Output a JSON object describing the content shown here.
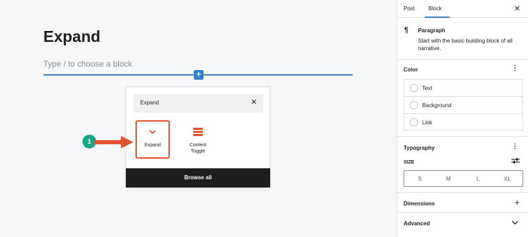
{
  "canvas": {
    "post_title": "Expand",
    "placeholder": "Type / to choose a block",
    "insert_plus": "+"
  },
  "inserter": {
    "search_value": "Expand",
    "clear_label": "✕",
    "blocks": [
      {
        "label": "Expand",
        "icon": "chevron-down-icon",
        "selected": true
      },
      {
        "label": "Content Toggle",
        "icon": "content-toggle-icon",
        "selected": false
      }
    ],
    "browse_all_label": "Browse all"
  },
  "callout": {
    "number": "1",
    "color": "#1aa385",
    "arrow_color": "#e1532e"
  },
  "sidebar": {
    "tabs": [
      {
        "label": "Post"
      },
      {
        "label": "Block",
        "active": true
      }
    ],
    "close_label": "✕",
    "block_card": {
      "icon": "¶",
      "name": "Paragraph",
      "description": "Start with the basic building block of all narrative."
    },
    "color": {
      "title": "Color",
      "options": [
        {
          "label": "Text"
        },
        {
          "label": "Background"
        },
        {
          "label": "Link"
        }
      ]
    },
    "typography": {
      "title": "Typography",
      "size_label": "SIZE",
      "sizes": [
        "S",
        "M",
        "L",
        "XL"
      ]
    },
    "dimensions": {
      "title": "Dimensions",
      "action": "+"
    },
    "advanced": {
      "title": "Advanced"
    }
  },
  "colors": {
    "accent": "#3b82c4",
    "highlight": "#e1532e"
  }
}
